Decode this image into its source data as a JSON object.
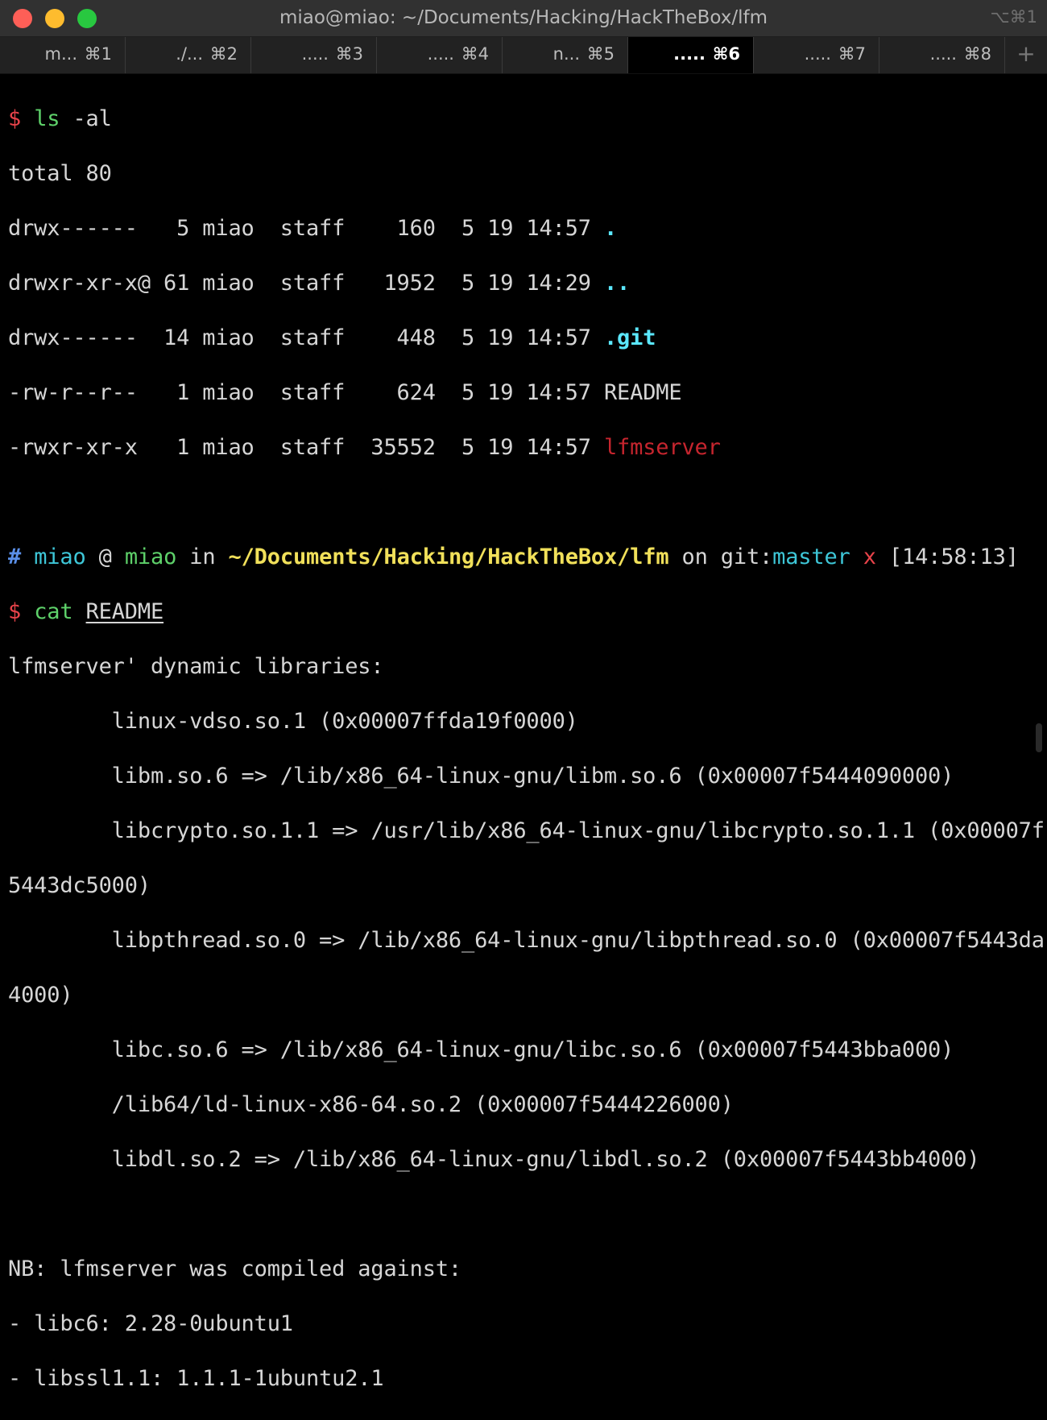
{
  "window": {
    "title": "miao@miao: ~/Documents/Hacking/HackTheBox/lfm",
    "shortcut": "⌥⌘1"
  },
  "tabs": [
    {
      "name": "m...",
      "key": "⌘1",
      "active": false
    },
    {
      "name": "./...",
      "key": "⌘2",
      "active": false
    },
    {
      "name": ".....",
      "key": "⌘3",
      "active": false
    },
    {
      "name": ".....",
      "key": "⌘4",
      "active": false
    },
    {
      "name": "n...",
      "key": "⌘5",
      "active": false
    },
    {
      "name": ".....",
      "key": "⌘6",
      "active": true
    },
    {
      "name": ".....",
      "key": "⌘7",
      "active": false
    },
    {
      "name": ".....",
      "key": "⌘8",
      "active": false
    }
  ],
  "new_tab_label": "+",
  "terminal": {
    "cmd1": {
      "prompt": "$",
      "command": "ls",
      "args": " -al"
    },
    "total": "total 80",
    "listing": [
      {
        "meta": "drwx------   5 miao  staff    160  5 19 14:57 ",
        "name": "."
      },
      {
        "meta": "drwxr-xr-x@ 61 miao  staff   1952  5 19 14:29 ",
        "name": ".."
      },
      {
        "meta": "drwx------  14 miao  staff    448  5 19 14:57 ",
        "name": ".git"
      },
      {
        "meta": "-rw-r--r--   1 miao  staff    624  5 19 14:57 ",
        "name": "README"
      },
      {
        "meta": "-rwxr-xr-x   1 miao  staff  35552  5 19 14:57 ",
        "name": "lfmserver"
      }
    ],
    "prompt_line": {
      "hash": "#",
      "user": "miao",
      "at": "@",
      "host": "miao",
      "in": "in",
      "path": "~/Documents/Hacking/HackTheBox/lfm",
      "on": "on",
      "git": "git:",
      "branch": "master",
      "dirty": "x",
      "time": "[14:58:13]"
    },
    "cmd2": {
      "prompt": "$",
      "command": "cat",
      "arg": "README"
    },
    "output": [
      "lfmserver' dynamic libraries:",
      "        linux-vdso.so.1 (0x00007ffda19f0000)",
      "        libm.so.6 => /lib/x86_64-linux-gnu/libm.so.6 (0x00007f5444090000)",
      "        libcrypto.so.1.1 => /usr/lib/x86_64-linux-gnu/libcrypto.so.1.1 (0x00007f",
      "5443dc5000)",
      "        libpthread.so.0 => /lib/x86_64-linux-gnu/libpthread.so.0 (0x00007f5443da",
      "4000)",
      "        libc.so.6 => /lib/x86_64-linux-gnu/libc.so.6 (0x00007f5443bba000)",
      "        /lib64/ld-linux-x86-64.so.2 (0x00007f5444226000)",
      "        libdl.so.2 => /lib/x86_64-linux-gnu/libdl.so.2 (0x00007f5443bb4000)",
      "",
      "NB: lfmserver was compiled against:",
      "- libc6: 2.28-0ubuntu1",
      "- libssl1.1: 1.1.1-1ubuntu2.1"
    ]
  }
}
